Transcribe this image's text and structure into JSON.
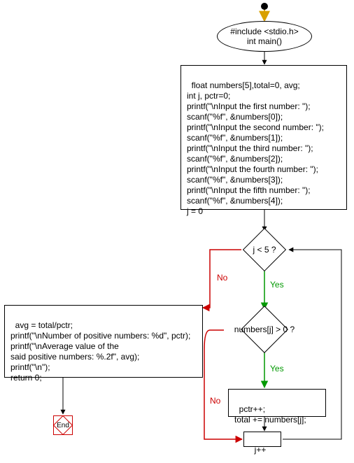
{
  "start": {
    "text": "#include <stdio.h>\nint main()"
  },
  "init_block": {
    "text": "float numbers[5],total=0, avg;\nint j, pctr=0;\nprintf(\"\\nInput the first number: \");\nscanf(\"%f\", &numbers[0]);\nprintf(\"\\nInput the second number: \");\nscanf(\"%f\", &numbers[1]);\nprintf(\"\\nInput the third number: \");\nscanf(\"%f\", &numbers[2]);\nprintf(\"\\nInput the fourth number: \");\nscanf(\"%f\", &numbers[3]);\nprintf(\"\\nInput the fifth number: \");\nscanf(\"%f\", &numbers[4]);\nj = 0"
  },
  "cond1": {
    "text": "j < 5 ?"
  },
  "cond2": {
    "text": "numbers[j] > 0 ?"
  },
  "accum_block": {
    "text": "pctr++;\ntotal += numbers[j];"
  },
  "inc_block": {
    "text": "j++"
  },
  "result_block": {
    "text": "avg = total/pctr;\nprintf(\"\\nNumber of positive numbers: %d\", pctr);\nprintf(\"\\nAverage value of the\nsaid positive numbers: %.2f\", avg);\nprintf(\"\\n\");\nreturn 0;"
  },
  "end": {
    "text": "End"
  },
  "labels": {
    "yes": "Yes",
    "no": "No"
  },
  "colors": {
    "yes": "#009900",
    "no": "#cc0000",
    "line": "#000000",
    "entry_arrow": "#d8a000"
  },
  "chart_data": {
    "type": "flowchart",
    "nodes": [
      {
        "id": "entry",
        "kind": "start-dot"
      },
      {
        "id": "main",
        "kind": "ellipse",
        "label": "#include <stdio.h>\nint main()"
      },
      {
        "id": "init",
        "kind": "process",
        "label": "float numbers[5],total=0, avg;\nint j, pctr=0;\nprintf(\"\\nInput the first number: \");\nscanf(\"%f\", &numbers[0]);\nprintf(\"\\nInput the second number: \");\nscanf(\"%f\", &numbers[1]);\nprintf(\"\\nInput the third number: \");\nscanf(\"%f\", &numbers[2]);\nprintf(\"\\nInput the fourth number: \");\nscanf(\"%f\", &numbers[3]);\nprintf(\"\\nInput the fifth number: \");\nscanf(\"%f\", &numbers[4]);\nj = 0"
      },
      {
        "id": "c1",
        "kind": "decision",
        "label": "j < 5 ?"
      },
      {
        "id": "c2",
        "kind": "decision",
        "label": "numbers[j] > 0 ?"
      },
      {
        "id": "accum",
        "kind": "process",
        "label": "pctr++;\ntotal += numbers[j];"
      },
      {
        "id": "inc",
        "kind": "process",
        "label": "j++"
      },
      {
        "id": "result",
        "kind": "process",
        "label": "avg = total/pctr;\nprintf(\"\\nNumber of positive numbers: %d\", pctr);\nprintf(\"\\nAverage value of the\nsaid positive numbers: %.2f\", avg);\nprintf(\"\\n\");\nreturn 0;"
      },
      {
        "id": "end",
        "kind": "terminator",
        "label": "End"
      }
    ],
    "edges": [
      {
        "from": "entry",
        "to": "main"
      },
      {
        "from": "main",
        "to": "init"
      },
      {
        "from": "init",
        "to": "c1"
      },
      {
        "from": "c1",
        "to": "c2",
        "label": "Yes"
      },
      {
        "from": "c1",
        "to": "result",
        "label": "No"
      },
      {
        "from": "c2",
        "to": "accum",
        "label": "Yes"
      },
      {
        "from": "c2",
        "to": "inc",
        "label": "No"
      },
      {
        "from": "accum",
        "to": "inc"
      },
      {
        "from": "inc",
        "to": "c1",
        "kind": "back"
      },
      {
        "from": "result",
        "to": "end"
      }
    ]
  }
}
